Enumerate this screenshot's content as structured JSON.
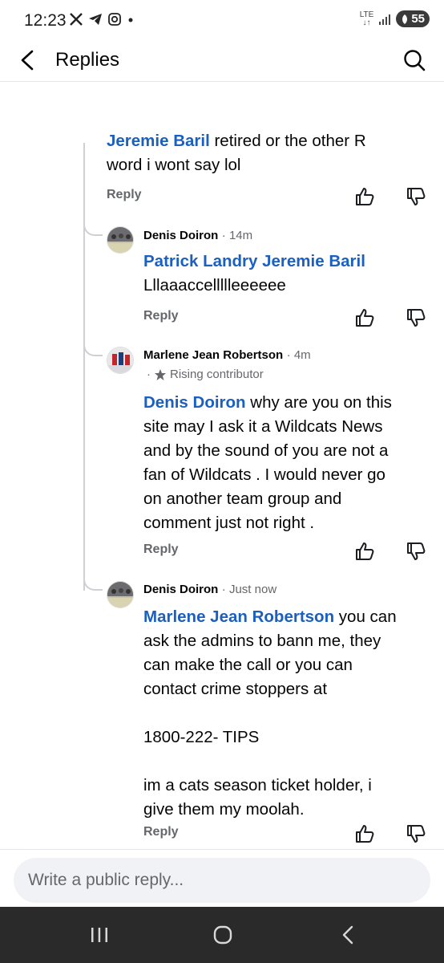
{
  "status": {
    "time": "12:23",
    "network": "LTE",
    "battery": "55"
  },
  "header": {
    "title": "Replies"
  },
  "comments": [
    {
      "mention": "Jeremie Baril",
      "text_lines": [
        "retired or the other R",
        "word i wont say lol"
      ],
      "reply_label": "Reply"
    },
    {
      "author": "Denis Doiron",
      "time": "14m",
      "mention": "Patrick Landry Jeremie Baril",
      "text": "Lllaaaccellllleeeeee",
      "reply_label": "Reply"
    },
    {
      "author": "Marlene Jean Robertson",
      "time": "4m",
      "badge": "Rising contributor",
      "mention": "Denis Doiron",
      "text_lines": [
        " why are you on this",
        "site may I ask it a Wildcats News",
        "and by the sound of you are not a",
        "fan of Wildcats . I would never go",
        "on another team group and",
        "comment just not right ."
      ],
      "reply_label": "Reply"
    },
    {
      "author": "Denis Doiron",
      "time": "Just now",
      "mention": "Marlene Jean Robertson",
      "text_lines": [
        " you can",
        "ask the admins to bann me, they",
        "can make the call or you can",
        "contact crime stoppers at",
        "",
        "1800-222- TIPS",
        "",
        "im a cats season ticket holder, i",
        "give them my moolah."
      ],
      "reply_label": "Reply"
    }
  ],
  "composer": {
    "placeholder": "Write a public reply..."
  }
}
